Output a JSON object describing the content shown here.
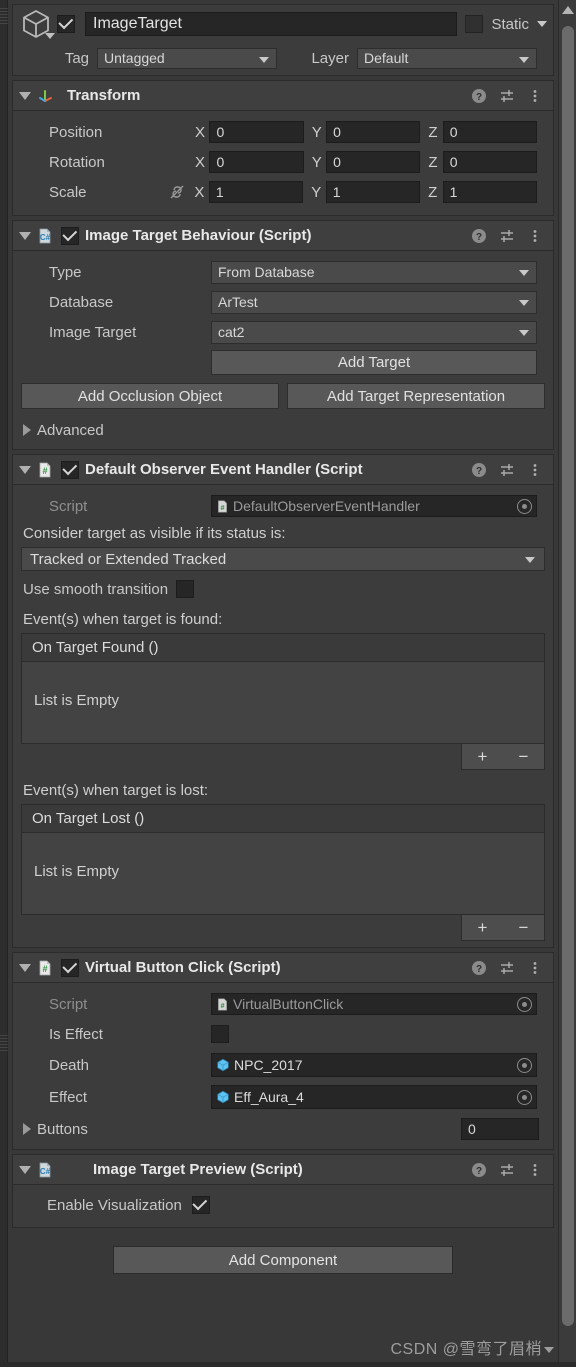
{
  "gameobject": {
    "enabled_checkbox": true,
    "name_value": "ImageTarget",
    "static_label": "Static",
    "static_checked": false,
    "tag_label": "Tag",
    "tag_value": "Untagged",
    "layer_label": "Layer",
    "layer_value": "Default"
  },
  "transform": {
    "title": "Transform",
    "rows": [
      {
        "label": "Position",
        "x": "0",
        "y": "0",
        "z": "0"
      },
      {
        "label": "Rotation",
        "x": "0",
        "y": "0",
        "z": "0"
      },
      {
        "label": "Scale",
        "x": "1",
        "y": "1",
        "z": "1"
      }
    ],
    "axis_x": "X",
    "axis_y": "Y",
    "axis_z": "Z"
  },
  "image_target_behaviour": {
    "title": "Image Target Behaviour (Script)",
    "enabled": true,
    "type_label": "Type",
    "type_value": "From Database",
    "database_label": "Database",
    "database_value": "ArTest",
    "image_target_label": "Image Target",
    "image_target_value": "cat2",
    "add_target_button": "Add Target",
    "add_occlusion_button": "Add Occlusion Object",
    "add_representation_button": "Add Target Representation",
    "advanced_label": "Advanced"
  },
  "default_observer": {
    "title": "Default Observer Event Handler (Script",
    "enabled": true,
    "script_label": "Script",
    "script_value": "DefaultObserverEventHandler",
    "status_label": "Consider target as visible if its status is:",
    "status_value": "Tracked or Extended Tracked",
    "smooth_label": "Use smooth transition",
    "smooth_checked": false,
    "found_section_label": "Event(s) when target is found:",
    "found_list_header": "On Target Found ()",
    "found_list_empty": "List is Empty",
    "lost_section_label": "Event(s) when target is lost:",
    "lost_list_header": "On Target Lost ()",
    "lost_list_empty": "List is Empty",
    "add_symbol": "+",
    "remove_symbol": "−"
  },
  "virtual_button_click": {
    "title": "Virtual Button Click (Script)",
    "enabled": true,
    "script_label": "Script",
    "script_value": "VirtualButtonClick",
    "is_effect_label": "Is Effect",
    "is_effect_checked": false,
    "death_label": "Death",
    "death_value": "NPC_2017",
    "effect_label": "Effect",
    "effect_value": "Eff_Aura_4",
    "buttons_label": "Buttons",
    "buttons_value": "0"
  },
  "image_target_preview": {
    "title": "Image Target Preview (Script)",
    "enable_visualization_label": "Enable Visualization",
    "enable_visualization_checked": true
  },
  "footer": {
    "add_component": "Add Component",
    "watermark": "CSDN @雪弯了眉梢"
  },
  "icons": {
    "help": "help-icon",
    "preset": "preset-icon",
    "menu": "kebab-menu-icon",
    "gameobject": "cube-icon",
    "transform": "transform-axis-icon",
    "script_cs": "csharp-script-icon",
    "script_hash": "hash-script-icon",
    "prefab": "prefab-cube-icon"
  },
  "colors": {
    "panel_bg": "#383838",
    "component_bg": "#3c3c3c",
    "field_bg": "#262626",
    "dropdown_bg": "#4a4a4a",
    "button_bg": "#585858",
    "text": "#c8c8c8",
    "prefab_blue": "#5ec3f0",
    "script_green": "#3a9a45"
  }
}
